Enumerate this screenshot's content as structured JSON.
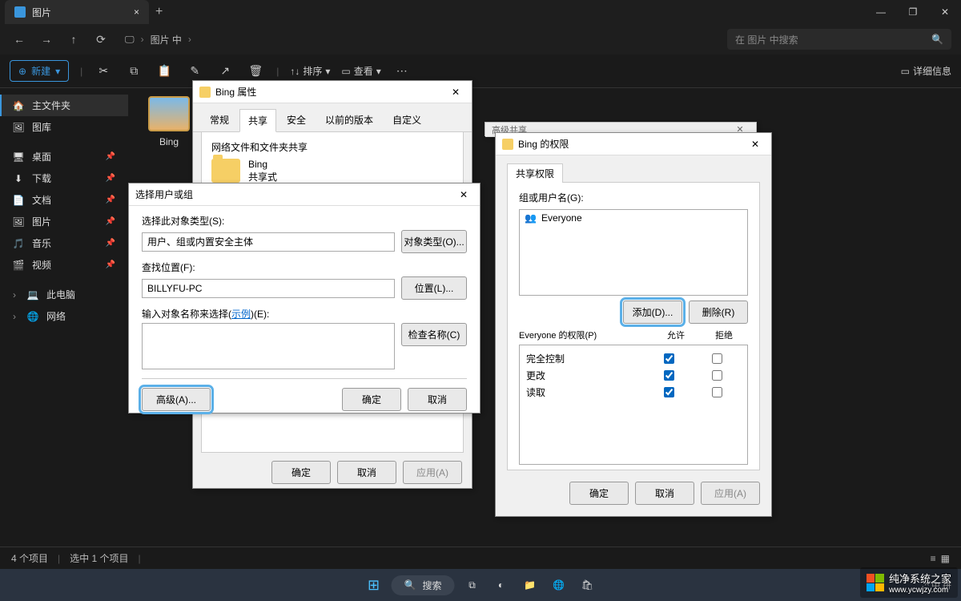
{
  "titlebar": {
    "tab_label": "图片",
    "close": "×",
    "newtab": "+"
  },
  "wincont": {
    "min": "—",
    "max": "❐",
    "close": "✕"
  },
  "nav": {
    "back": "←",
    "fwd": "→",
    "up": "↑",
    "refresh": "⟳",
    "monitor": "🖵",
    "crumb1": "图片 中",
    "search_ph": "在 图片 中搜索",
    "search_icon": "🔍"
  },
  "toolbar": {
    "new_label": "新建",
    "new_icon": "⊕",
    "cut": "✂",
    "copy": "⧉",
    "paste": "📋",
    "rename": "✎",
    "share": "↗",
    "delete": "🗑",
    "sort_label": "排序",
    "view_label": "查看",
    "more": "⋯",
    "details_icon": "▭",
    "details_label": "详细信息"
  },
  "sidebar": {
    "items": [
      {
        "icon": "🏠",
        "label": "主文件夹",
        "active": true
      },
      {
        "icon": "🖼",
        "label": "图库"
      }
    ],
    "pinned": [
      {
        "icon": "🖥",
        "label": "桌面"
      },
      {
        "icon": "⬇",
        "label": "下载"
      },
      {
        "icon": "📄",
        "label": "文档"
      },
      {
        "icon": "🖼",
        "label": "图片"
      },
      {
        "icon": "🎵",
        "label": "音乐"
      },
      {
        "icon": "🎬",
        "label": "视频"
      }
    ],
    "bottom": [
      {
        "icon": "💻",
        "label": "此电脑",
        "exp": "›"
      },
      {
        "icon": "🌐",
        "label": "网络",
        "exp": "›"
      }
    ]
  },
  "content": {
    "folder_name": "Bing"
  },
  "status": {
    "left": "4 个项目",
    "right": "选中 1 个项目"
  },
  "prop": {
    "title": "Bing 属性",
    "tabs": [
      "常规",
      "共享",
      "安全",
      "以前的版本",
      "自定义"
    ],
    "active_tab": 1,
    "section_title": "网络文件和文件夹共享",
    "obj_name": "Bing",
    "share_state": "共享式",
    "ok": "确定",
    "cancel": "取消",
    "apply": "应用(A)"
  },
  "seluser": {
    "title": "选择用户或组",
    "lbl_objtype": "选择此对象类型(S):",
    "objtype_val": "用户、组或内置安全主体",
    "btn_objtype": "对象类型(O)...",
    "lbl_loc": "查找位置(F):",
    "loc_val": "BILLYFU-PC",
    "btn_loc": "位置(L)...",
    "lbl_enter_pre": "输入对象名称来选择(",
    "link_ex": "示例",
    "lbl_enter_post": ")(E):",
    "enter_val": "",
    "btn_check": "检查名称(C)",
    "btn_adv": "高级(A)...",
    "ok": "确定",
    "cancel": "取消"
  },
  "advshare": {
    "title": "高级共享"
  },
  "perm": {
    "title": "Bing 的权限",
    "tab": "共享权限",
    "lbl_groups": "组或用户名(G):",
    "user_icon": "👥",
    "user": "Everyone",
    "btn_add": "添加(D)...",
    "btn_remove": "删除(R)",
    "lbl_perm_for": "Everyone 的权限(P)",
    "col_allow": "允许",
    "col_deny": "拒绝",
    "rows": [
      {
        "label": "完全控制",
        "allow": true,
        "deny": false
      },
      {
        "label": "更改",
        "allow": true,
        "deny": false
      },
      {
        "label": "读取",
        "allow": true,
        "deny": false
      }
    ],
    "ok": "确定",
    "cancel": "取消",
    "apply": "应用(A)"
  },
  "taskbar": {
    "start": "⊞",
    "search_icon": "🔍",
    "search_label": "搜索",
    "systray": "^  中  拼"
  },
  "watermark": {
    "line1": "纯净系统之家",
    "line2": "www.ycwjzy.com"
  }
}
